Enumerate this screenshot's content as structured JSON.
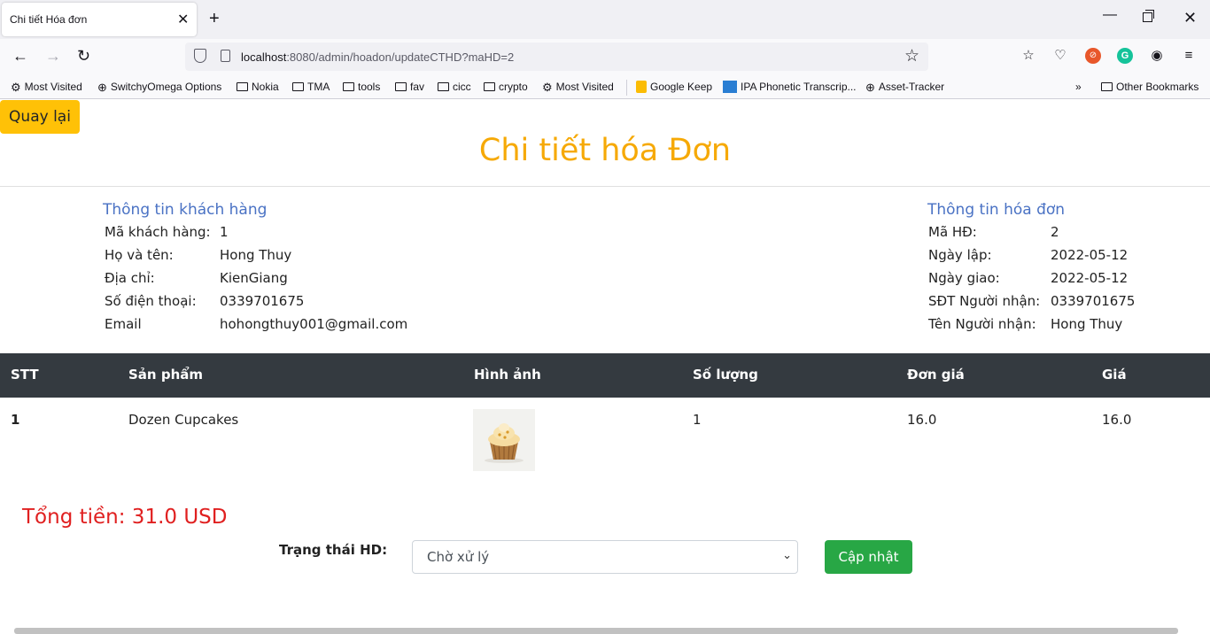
{
  "browser": {
    "tab_title": "Chi tiết Hóa đơn",
    "url_host": "localhost",
    "url_rest": ":8080/admin/hoadon/updateCTHD?maHD=2",
    "bookmarks": [
      "Most Visited",
      "SwitchyOmega Options",
      "Nokia",
      "TMA",
      "tools",
      "fav",
      "cicc",
      "crypto",
      "Most Visited",
      "Google Keep",
      "IPA Phonetic Transcrip...",
      "Asset-Tracker"
    ],
    "other_bookmarks": "Other Bookmarks"
  },
  "page": {
    "back_label": "Quay lại",
    "title": "Chi tiết hóa Đơn"
  },
  "customer": {
    "title": "Thông tin khách hàng",
    "rows": [
      {
        "label": "Mã khách hàng:",
        "value": "1"
      },
      {
        "label": "Họ và tên:",
        "value": "Hong Thuy"
      },
      {
        "label": "Địa chỉ:",
        "value": "KienGiang"
      },
      {
        "label": "Số điện thoại:",
        "value": "0339701675"
      },
      {
        "label": "Email",
        "value": "hohongthuy001@gmail.com"
      }
    ]
  },
  "invoice": {
    "title": "Thông tin hóa đơn",
    "rows": [
      {
        "label": "Mã HĐ:",
        "value": "2"
      },
      {
        "label": "Ngày lập:",
        "value": "2022-05-12"
      },
      {
        "label": "Ngày giao:",
        "value": "2022-05-12"
      },
      {
        "label": "SĐT Người nhận:",
        "value": "0339701675"
      },
      {
        "label": "Tên Người nhận:",
        "value": "Hong Thuy"
      }
    ]
  },
  "table": {
    "headers": [
      "STT",
      "Sản phẩm",
      "Hình ảnh",
      "Số lượng",
      "Đơn giá",
      "Giá"
    ],
    "rows": [
      {
        "stt": "1",
        "product": "Dozen Cupcakes",
        "quantity": "1",
        "unit_price": "16.0",
        "price": "16.0"
      }
    ]
  },
  "total_text": "Tổng tiền: 31.0 USD",
  "status": {
    "label": "Trạng thái HD:",
    "selected": "Chờ xử lý",
    "update_label": "Cập nhật"
  }
}
